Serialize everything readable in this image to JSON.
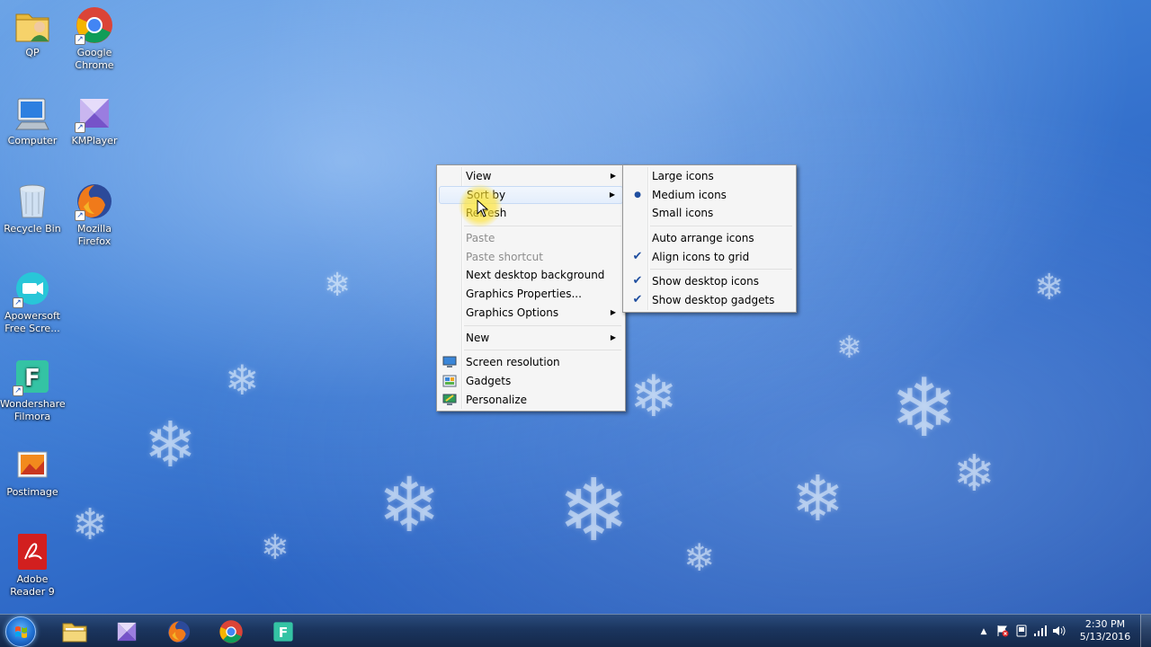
{
  "desktop": {
    "icons": [
      {
        "label": "QP",
        "icon": "user-folder-icon"
      },
      {
        "label": "Google\nChrome",
        "icon": "chrome-icon"
      },
      {
        "label": "Computer",
        "icon": "computer-icon"
      },
      {
        "label": "KMPlayer",
        "icon": "kmplayer-icon"
      },
      {
        "label": "Recycle Bin",
        "icon": "recycle-bin-icon"
      },
      {
        "label": "Mozilla\nFirefox",
        "icon": "firefox-icon"
      },
      {
        "label": "Apowersoft\nFree Scre...",
        "icon": "apowersoft-icon"
      },
      {
        "label": "Wondershare\nFilmora",
        "icon": "filmora-icon"
      },
      {
        "label": "Postimage",
        "icon": "postimage-icon"
      },
      {
        "label": "Adobe\nReader 9",
        "icon": "adobe-reader-icon"
      }
    ]
  },
  "context_menu": {
    "items": {
      "view": "View",
      "sort_by": "Sort by",
      "refresh": "Refresh",
      "paste": "Paste",
      "paste_shortcut": "Paste shortcut",
      "next_background": "Next desktop background",
      "graphics_properties": "Graphics Properties...",
      "graphics_options": "Graphics Options",
      "new": "New",
      "screen_resolution": "Screen resolution",
      "gadgets": "Gadgets",
      "personalize": "Personalize"
    }
  },
  "view_submenu": {
    "items": {
      "large_icons": "Large icons",
      "medium_icons": "Medium icons",
      "small_icons": "Small icons",
      "auto_arrange": "Auto arrange icons",
      "align_grid": "Align icons to grid",
      "show_icons": "Show desktop icons",
      "show_gadgets": "Show desktop gadgets"
    },
    "selected_size": "Medium icons",
    "checked": [
      "Align icons to grid",
      "Show desktop icons",
      "Show desktop gadgets"
    ]
  },
  "taskbar": {
    "pinned": [
      "windows-explorer-icon",
      "kmplayer-icon",
      "firefox-icon",
      "chrome-icon",
      "filmora-icon"
    ],
    "clock": {
      "time": "2:30 PM",
      "date": "5/13/2016"
    }
  },
  "colors": {
    "menu_bg": "#f5f5f5",
    "menu_border": "#979797",
    "hover_bg": "#e4eefc",
    "taskbar": "#1b355e",
    "desktop_blue": "#2a63c3"
  }
}
